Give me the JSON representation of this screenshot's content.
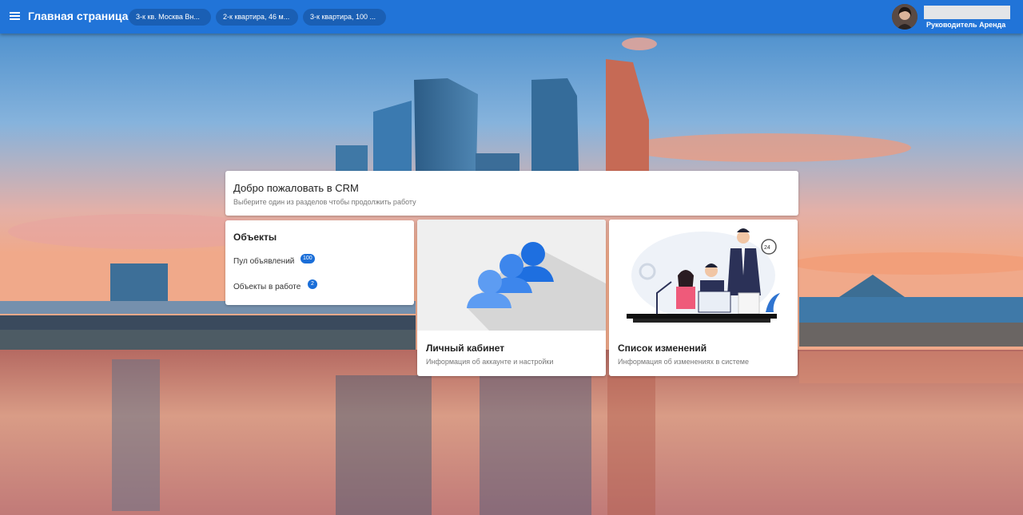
{
  "header": {
    "title": "Главная страница",
    "tabs": [
      {
        "label": "3-к кв. Москва Вн..."
      },
      {
        "label": "2-к квартира, 46 м..."
      },
      {
        "label": "3-к квартира, 100 ..."
      }
    ],
    "user": {
      "name": "",
      "role": "Руководитель Аренда"
    }
  },
  "welcome": {
    "title": "Добро пожаловать в CRM",
    "subtitle": "Выберите один из разделов чтобы продолжить работу"
  },
  "objects": {
    "title": "Объекты",
    "links": [
      {
        "label": "Пул объявлений",
        "badge": "100"
      },
      {
        "label": "Объекты в работе",
        "badge": "2"
      }
    ]
  },
  "tiles": {
    "cabinet": {
      "title": "Личный кабинет",
      "subtitle": "Информация об аккаунте и настройки",
      "icon": "users-icon"
    },
    "changes": {
      "title": "Список изменений",
      "subtitle": "Информация об изменениях в системе",
      "icon": "team-illustration"
    }
  },
  "colors": {
    "appbar": "#2174d8",
    "chip": "#1a5fb4",
    "accent": "#1a6ed8"
  }
}
